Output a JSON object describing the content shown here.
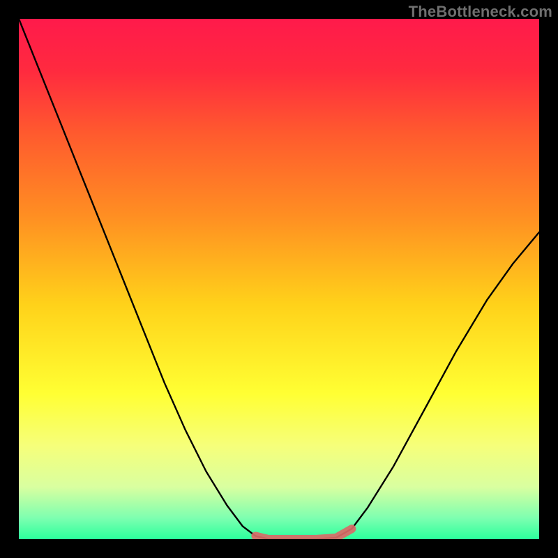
{
  "watermark": "TheBottleneck.com",
  "chart_data": {
    "type": "line",
    "title": "",
    "xlabel": "",
    "ylabel": "",
    "xlim": [
      0,
      1
    ],
    "ylim": [
      0,
      1
    ],
    "grid": false,
    "legend": false,
    "gradient_stops": [
      {
        "offset": 0.0,
        "color": "#ff1a4b"
      },
      {
        "offset": 0.1,
        "color": "#ff2a3f"
      },
      {
        "offset": 0.22,
        "color": "#ff5a2e"
      },
      {
        "offset": 0.38,
        "color": "#ff8f22"
      },
      {
        "offset": 0.55,
        "color": "#ffd21a"
      },
      {
        "offset": 0.72,
        "color": "#ffff33"
      },
      {
        "offset": 0.82,
        "color": "#f6ff7a"
      },
      {
        "offset": 0.9,
        "color": "#d9ffa0"
      },
      {
        "offset": 0.96,
        "color": "#7cffb0"
      },
      {
        "offset": 1.0,
        "color": "#2bff9c"
      }
    ],
    "series": [
      {
        "name": "curve",
        "stroke": "#000000",
        "width": 2.4,
        "x": [
          0.0,
          0.04,
          0.08,
          0.12,
          0.16,
          0.2,
          0.24,
          0.28,
          0.32,
          0.36,
          0.4,
          0.43,
          0.455,
          0.48,
          0.5,
          0.53,
          0.57,
          0.61,
          0.64,
          0.67,
          0.72,
          0.78,
          0.84,
          0.9,
          0.95,
          1.0
        ],
        "y": [
          1.0,
          0.9,
          0.8,
          0.7,
          0.6,
          0.5,
          0.4,
          0.3,
          0.21,
          0.13,
          0.065,
          0.025,
          0.006,
          0.0,
          0.0,
          0.0,
          0.0,
          0.003,
          0.02,
          0.06,
          0.14,
          0.25,
          0.36,
          0.46,
          0.53,
          0.59
        ]
      },
      {
        "name": "plateau",
        "stroke": "#d96a67",
        "width": 12,
        "x": [
          0.455,
          0.48,
          0.5,
          0.53,
          0.57,
          0.61,
          0.64
        ],
        "y": [
          0.006,
          0.0,
          0.0,
          0.0,
          0.0,
          0.003,
          0.02
        ]
      }
    ]
  }
}
